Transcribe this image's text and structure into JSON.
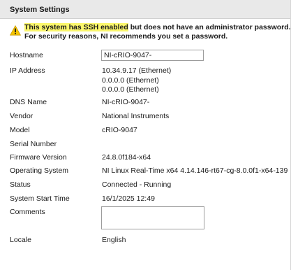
{
  "panel": {
    "title": "System Settings"
  },
  "warning": {
    "icon": "warning-triangle-icon",
    "icon_color": "#f5c400",
    "highlight_color": "#fbf76c",
    "line1_highlight": "This system has SSH enabled",
    "line1_rest": " but does not have an administrator password.",
    "line2": "For security reasons, NI recommends you set a password."
  },
  "fields": {
    "hostname": {
      "label": "Hostname",
      "value": "NI-cRIO-9047-"
    },
    "ip_address": {
      "label": "IP Address",
      "values": [
        "10.34.9.17 (Ethernet)",
        "0.0.0.0 (Ethernet)",
        "0.0.0.0 (Ethernet)"
      ]
    },
    "dns_name": {
      "label": "DNS Name",
      "value": "NI-cRIO-9047-"
    },
    "vendor": {
      "label": "Vendor",
      "value": "National Instruments"
    },
    "model": {
      "label": "Model",
      "value": "cRIO-9047"
    },
    "serial_number": {
      "label": "Serial Number",
      "value": ""
    },
    "firmware_version": {
      "label": "Firmware Version",
      "value": "24.8.0f184-x64"
    },
    "operating_system": {
      "label": "Operating System",
      "value": "NI Linux Real-Time x64 4.14.146-rt67-cg-8.0.0f1-x64-139"
    },
    "status": {
      "label": "Status",
      "value": "Connected - Running"
    },
    "system_start_time": {
      "label": "System Start Time",
      "value": "16/1/2025 12:49"
    },
    "comments": {
      "label": "Comments",
      "value": ""
    },
    "locale": {
      "label": "Locale",
      "value": "English"
    }
  }
}
